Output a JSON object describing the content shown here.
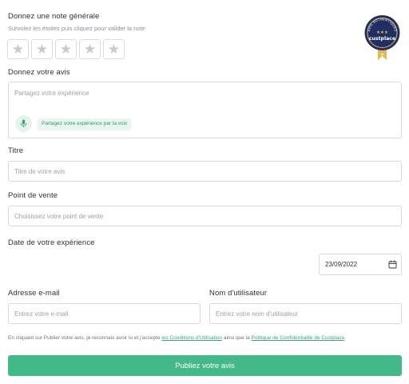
{
  "rating": {
    "title": "Donnez une note générale",
    "hint": "Survolez les étoiles puis cliquez pour valider la note",
    "star_glyph": "★",
    "max_stars": 5,
    "selected": 0
  },
  "badge": {
    "top_text": "AVIS AUTHENTIQUES",
    "brand": "custplace",
    "colors": {
      "navy": "#1f2f63",
      "gold": "#e9b84a"
    }
  },
  "review": {
    "label": "Donnez votre avis",
    "placeholder": "Partagez votre expérience",
    "voice_label": "Partagez votre expérience par la voix"
  },
  "title_field": {
    "label": "Titre",
    "placeholder": "Titre de votre avis"
  },
  "store_field": {
    "label": "Point de vente",
    "placeholder": "Choisissez votre point de vente"
  },
  "date_field": {
    "label": "Date de votre expérience",
    "value": "23/09/2022"
  },
  "email_field": {
    "label": "Adresse e-mail",
    "placeholder": "Entrez votre e-mail"
  },
  "username_field": {
    "label": "Nom d'utilisateur",
    "placeholder": "Entrez votre nom d'utilisateur"
  },
  "legal": {
    "part1": "En cliquant sur Publier votre avis, je reconnais avoir lu et j'accepte ",
    "terms_link": "les Conditions d'Utilisation",
    "part2": " ainsi que la ",
    "privacy_link": "Politique de Confidentialité de Custplace",
    "part3": "."
  },
  "submit_label": "Publiez votre avis",
  "colors": {
    "accent": "#43b98a",
    "link": "#3aa578",
    "border": "#d6d9df"
  }
}
